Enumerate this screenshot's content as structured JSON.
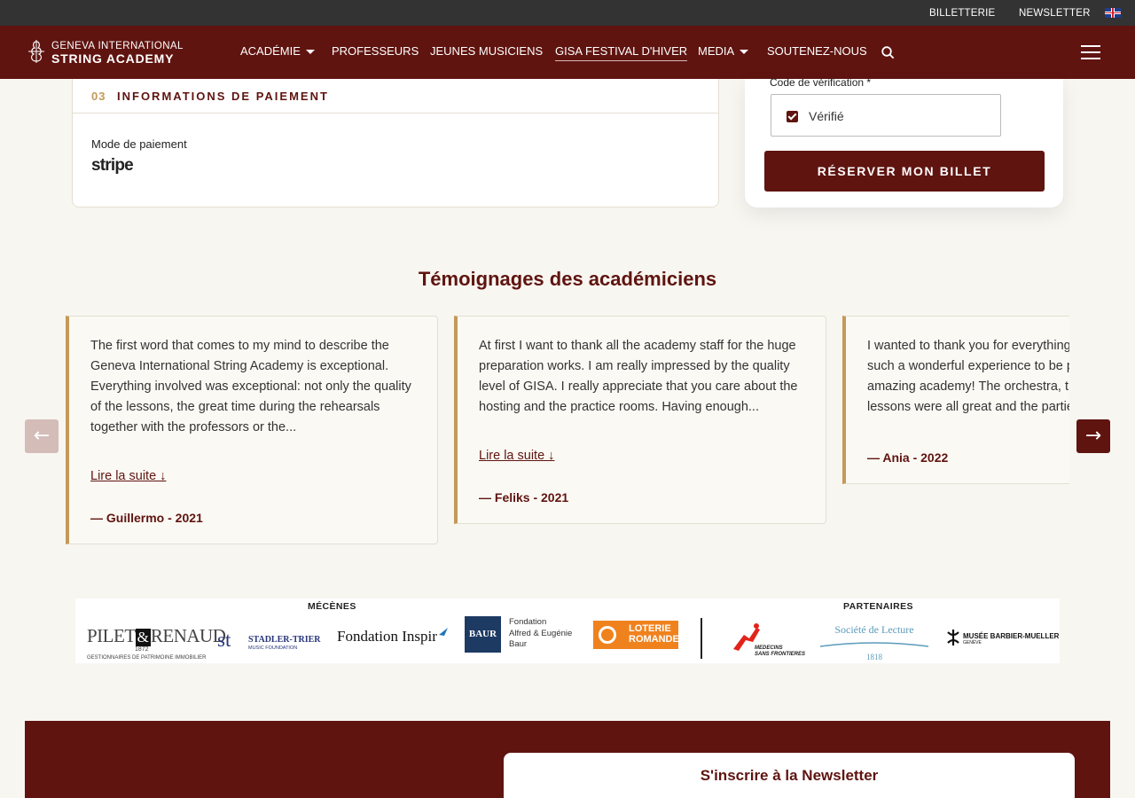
{
  "topbar": {
    "ticketing": "BILLETTERIE",
    "newsletter": "NEWSLETTER",
    "language_icon": "uk-flag-icon"
  },
  "nav": {
    "logo_line1": "GENEVA INTERNATIONAL",
    "logo_line2": "STRING ACADEMY",
    "items": [
      {
        "label": "ACADÉMIE"
      },
      {
        "label": "PROFESSEURS"
      },
      {
        "label": "JEUNES MUSICIENS"
      },
      {
        "label": "GISA FESTIVAL D'HIVER"
      },
      {
        "label": "MEDIA"
      },
      {
        "label": "SOUTENEZ-NOUS"
      }
    ]
  },
  "payment": {
    "step_number": "03",
    "title": "INFORMATIONS DE PAIEMENT",
    "method_label": "Mode de paiement",
    "provider": "stripe"
  },
  "verification": {
    "label": "Code de vérification *",
    "status": "Vérifié",
    "submit_label": "RÉSERVER MON BILLET"
  },
  "testimonials": {
    "title": "Témoignages des académiciens",
    "prev_label": "←",
    "next_label": "→",
    "items": [
      {
        "text": "The first word that comes to my mind to describe the Geneva International String Academy is exceptional. Everything involved was exceptional: not only the quality of the lessons, the great time during the rehearsals together with the professors or the...",
        "more": "Lire la suite ↓",
        "author": "— Guillermo - 2021"
      },
      {
        "text": "At first I want to thank all the academy staff for the huge preparation works. I am really impressed by the quality level of GISA. I really appreciate that you care about the hosting and the practice rooms. Having enough...",
        "more": "Lire la suite ↓",
        "author": "— Feliks - 2021"
      },
      {
        "text": "I wanted to thank you for everything, for me/us it was such a wonderful experience to be part of such an amazing academy! The orchestra, the chamber music, lessons were all great and the parties were so much fun!",
        "author": "— Ania - 2022"
      }
    ]
  },
  "sponsors": {
    "patrons_heading": "MÉCÈNES",
    "partners_heading": "PARTENAIRES",
    "pilet_name": "PILET",
    "pilet_amp": "&",
    "pilet_renaud": "RENAUD",
    "pilet_year": "1872",
    "pilet_sub": "GESTIONNAIRES DE PATRIMOINE IMMOBILIER",
    "stadler_mark": "st",
    "stadler_name": "STADLER-TRIER",
    "stadler_sub": "MUSIC FOUNDATION",
    "inspir_name": "Fondation Inspir",
    "baur_mark": "BAUR",
    "baur_l1": "Fondation",
    "baur_l2": "Alfred & Eugénie",
    "baur_l3": "Baur",
    "loterie_l1": "LOTERIE",
    "loterie_l2": "ROMANDE",
    "msf_l1": "MEDECINS",
    "msf_l2": "SANS FRONTIERES",
    "lecture_name": "Société de Lecture",
    "lecture_year": "1818",
    "musee_name": "MUSÉE BARBIER-MUELLER",
    "musee_sub": "GENÈVE"
  },
  "footer": {
    "newsletter_title": "S'inscrire à la Newsletter"
  },
  "colors": {
    "brand": "#5f1410",
    "accent": "#c39a58",
    "page_bg": "#f8f6f1",
    "topbar_bg": "#333333"
  }
}
